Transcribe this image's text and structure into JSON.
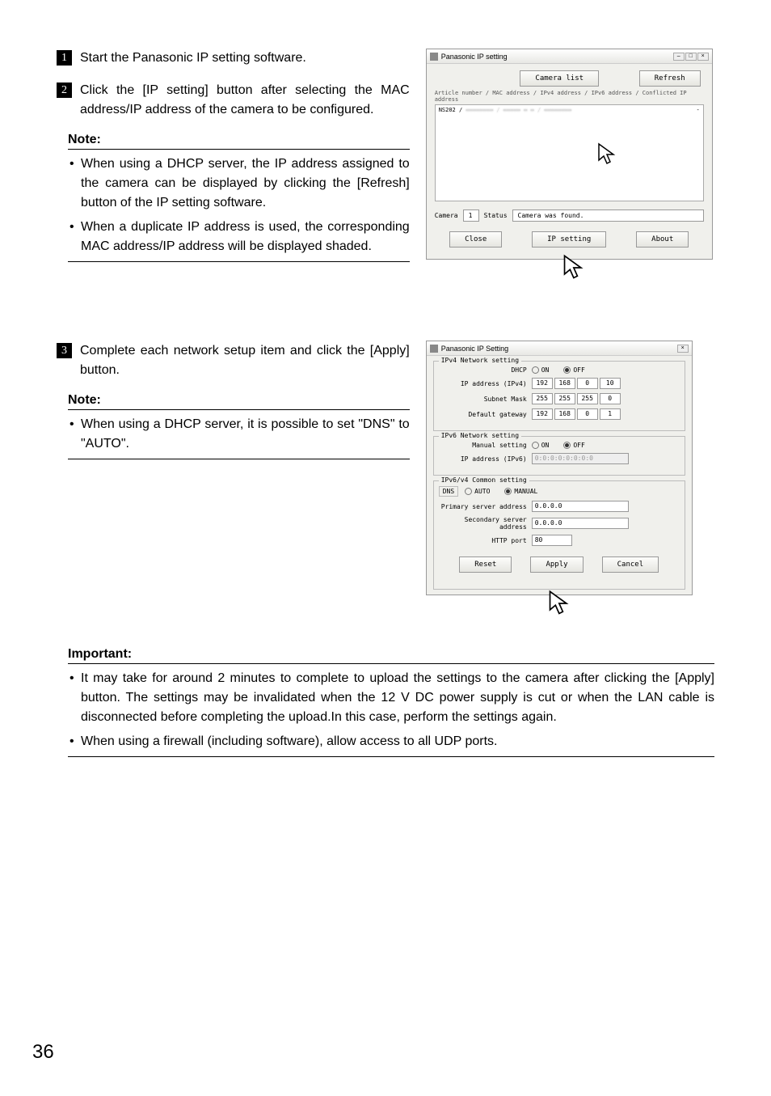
{
  "steps": {
    "s1": {
      "num": "1",
      "text": "Start the Panasonic IP setting software."
    },
    "s2": {
      "num": "2",
      "text": "Click the [IP setting] button after selecting the MAC address/IP address of the camera to be configured."
    },
    "s3": {
      "num": "3",
      "text": "Complete each network setup item and click the [Apply] button."
    }
  },
  "note1": {
    "heading": "Note:",
    "items": [
      "When using a DHCP server, the IP address assigned to the camera can be displayed by clicking the [Refresh] button of the IP setting software.",
      "When a duplicate IP address is used, the corresponding MAC address/IP address will be displayed shaded."
    ]
  },
  "note2": {
    "heading": "Note:",
    "items": [
      "When using a DHCP server, it is possible to set \"DNS\" to \"AUTO\"."
    ]
  },
  "important": {
    "heading": "Important:",
    "items": [
      "It may take for around 2 minutes to complete to upload the settings to the camera after clicking the [Apply] button. The settings may be invalidated when the 12 V DC power supply is cut or when the LAN cable is disconnected before completing the upload.In this case, perform the settings again.",
      "When using a firewall (including software), allow access to all UDP ports."
    ]
  },
  "page": "36",
  "win1": {
    "title": "Panasonic IP setting",
    "camera_list_btn": "Camera list",
    "refresh_btn": "Refresh",
    "columns": "Article number / MAC address / IPv4 address / IPv6 address / Conflicted IP address",
    "row_id": "NS202 /",
    "row_dash": "-",
    "camera_label": "Camera",
    "camera_value": "1",
    "status_label": "Status",
    "status_value": "Camera was found.",
    "close_btn": "Close",
    "ipsetting_btn": "IP setting",
    "about_btn": "About"
  },
  "win2": {
    "title": "Panasonic IP Setting",
    "g1_label": "IPv4 Network setting",
    "dhcp": "DHCP",
    "on": "ON",
    "off": "OFF",
    "ip_label": "IP address (IPv4)",
    "ipv4": [
      "192",
      "168",
      "0",
      "10"
    ],
    "subnet_label": "Subnet Mask",
    "subnet": [
      "255",
      "255",
      "255",
      "0"
    ],
    "gw_label": "Default gateway",
    "gw": [
      "192",
      "168",
      "0",
      "1"
    ],
    "g2_label": "IPv6 Network setting",
    "manual_label": "Manual setting",
    "ip6_label": "IP address (IPv6)",
    "ip6_val": "0:0:0:0:0:0:0:0",
    "g3_label": "IPv6/v4 Common setting",
    "dns_label": "DNS",
    "auto": "AUTO",
    "manual": "MANUAL",
    "psa_label": "Primary server address",
    "psa": "0.0.0.0",
    "ssa_label": "Secondary server address",
    "ssa": "0.0.0.0",
    "port_label": "HTTP port",
    "port": "80",
    "reset_btn": "Reset",
    "apply_btn": "Apply",
    "cancel_btn": "Cancel"
  }
}
